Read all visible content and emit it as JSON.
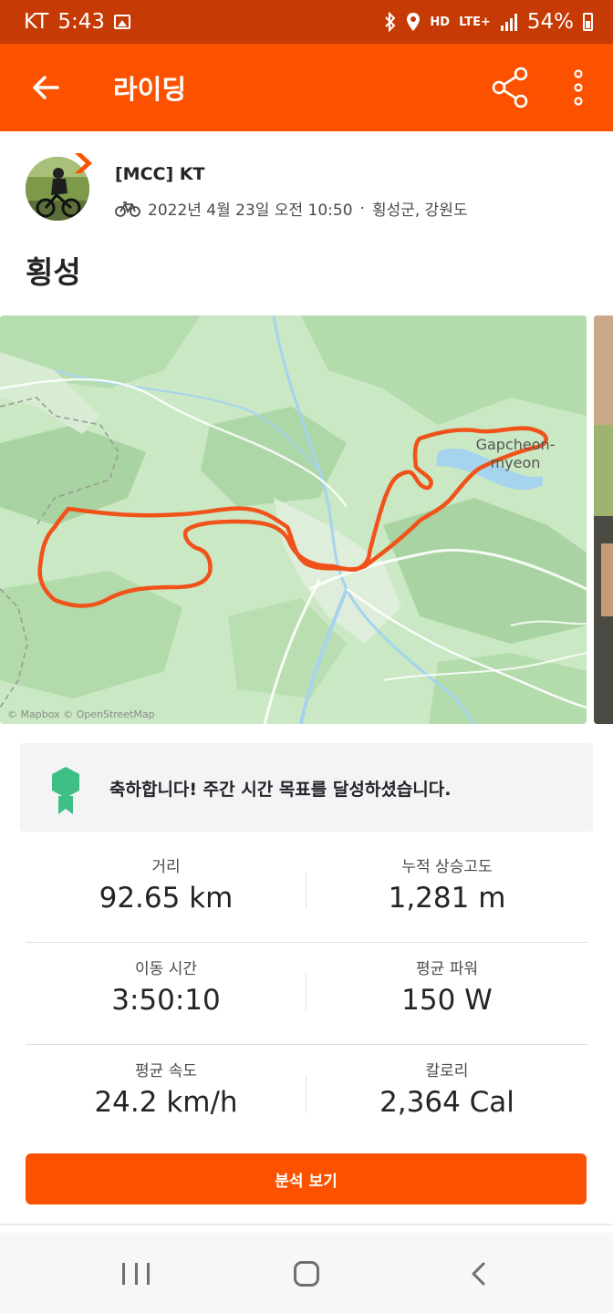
{
  "status_bar": {
    "carrier": "KT",
    "time": "5:43",
    "hd": "HD",
    "network": "LTE+",
    "battery": "54%"
  },
  "app_bar": {
    "title": "라이딩",
    "back_icon": "arrow-left-icon",
    "share_icon": "share-icon",
    "more_icon": "more-vertical-icon"
  },
  "header": {
    "athlete": "[MCC] KT",
    "datetime": "2022년 4월 23일 오전 10:50",
    "location": "횡성군, 강원도",
    "separator": "·"
  },
  "activity": {
    "title": "횡성"
  },
  "map": {
    "place_label_1": "Gapcheon-",
    "place_label_2": "myeon",
    "attribution": "© Mapbox © OpenStreetMap"
  },
  "achievement": {
    "text": "축하합니다! 주간 시간 목표를 달성하셨습니다.",
    "icon": "medal-icon"
  },
  "stats": [
    {
      "left": {
        "label": "거리",
        "value": "92.65 km"
      },
      "right": {
        "label": "누적 상승고도",
        "value": "1,281 m"
      }
    },
    {
      "left": {
        "label": "이동 시간",
        "value": "3:50:10"
      },
      "right": {
        "label": "평균 파워",
        "value": "150 W"
      }
    },
    {
      "left": {
        "label": "평균 속도",
        "value": "24.2 km/h"
      },
      "right": {
        "label": "칼로리",
        "value": "2,364 Cal"
      }
    }
  ],
  "actions": {
    "analysis_label": "분석 보기"
  },
  "colors": {
    "brand": "#fc5200",
    "status_bar": "#c63a05",
    "route": "#f0521a",
    "map_green": "#c9e8c3"
  }
}
